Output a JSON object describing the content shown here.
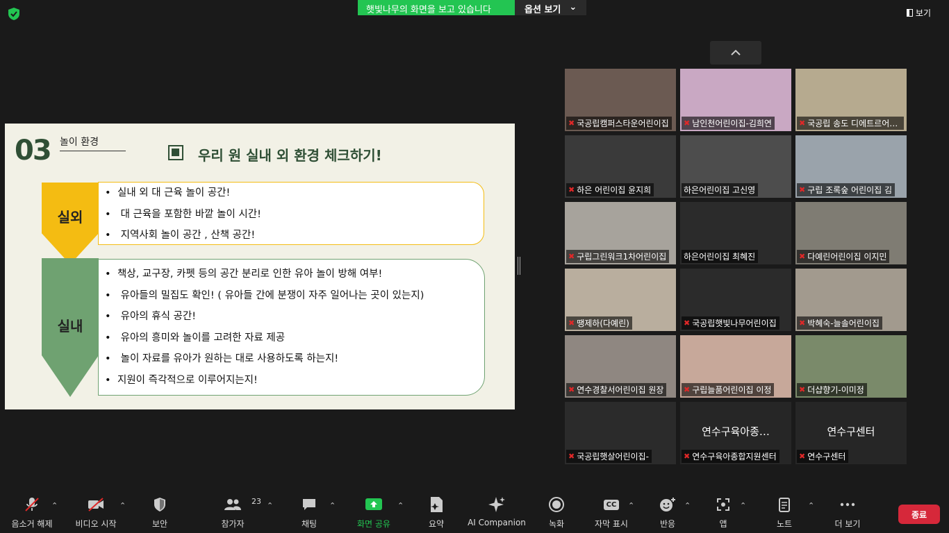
{
  "top": {
    "banner_text": "햇빛나무의 화면을 보고 있습니다",
    "options_label": "옵션 보기",
    "view_label": "보기"
  },
  "slide": {
    "number": "03",
    "section": "놀이 환경",
    "title": "우리 원 실내 외 환경 체크하기!",
    "outdoor_label": "실외",
    "outdoor_items": [
      "실내 외  대 근육 놀이 공간!",
      " 대 근육을 포함한 바깥 놀이 시간!",
      " 지역사회 놀이 공간 , 산책 공간!"
    ],
    "indoor_label": "실내",
    "indoor_items": [
      "책상, 교구장, 카펫 등의 공간 분리로 인한 유아 놀이 방해 여부!",
      " 유아들의 밀집도 확인! ( 유아들 간에 분쟁이 자주 일어나는 곳이 있는지)",
      " 유아의 휴식 공간!",
      " 유아의 흥미와 놀이를 고려한 자료 제공",
      " 놀이 자료를 유아가 원하는 대로 사용하도록 하는지!",
      "지원이 즉각적으로 이루어지는지!"
    ]
  },
  "participants": [
    {
      "name": "국공립캠퍼스타운어린이집",
      "muted": true,
      "bg": "#6b5a52"
    },
    {
      "name": "남인천어린이집-김희연",
      "muted": true,
      "bg": "#c9a8c3"
    },
    {
      "name": "국공립 송도 디에트르어린이집",
      "muted": true,
      "bg": "#b6aa8f"
    },
    {
      "name": "하은 어린이집 윤지희",
      "muted": true,
      "bg": "#3a3a3a"
    },
    {
      "name": "하은어린이집 고신영",
      "muted": false,
      "bg": "#4d4d4d"
    },
    {
      "name": "구립 조록숲 어린이집 김",
      "muted": true,
      "bg": "#9aa3ab"
    },
    {
      "name": "구립그린워크1차어린이집",
      "muted": true,
      "bg": "#a7a39c"
    },
    {
      "name": "하은어린이집 최혜진",
      "muted": false,
      "bg": "#2b2b2b"
    },
    {
      "name": "다예린어린이집 이지민",
      "muted": true,
      "bg": "#7f7c73"
    },
    {
      "name": "땡제하(다예린)",
      "muted": true,
      "bg": "#b9ae9e"
    },
    {
      "name": "국공립햇빛나무어린이집",
      "muted": true,
      "bg": "#2b2b2b"
    },
    {
      "name": "박혜숙-늘솔어린이집",
      "muted": true,
      "bg": "#a29a8e"
    },
    {
      "name": "연수경찰서어린이집 원장",
      "muted": true,
      "bg": "#8f8781"
    },
    {
      "name": "구립늘품어린이집 이정",
      "muted": true,
      "bg": "#c7a89a"
    },
    {
      "name": "더샵향기-이미정",
      "muted": true,
      "bg": "#7a8a6a"
    },
    {
      "name": "국공립햇살어린이집-",
      "muted": true,
      "bg": "#2b2b2b"
    },
    {
      "name": "연수구육아종합지원센터",
      "muted": true,
      "bg": "#262626",
      "center": "연수구육아종…"
    },
    {
      "name": "연수구센터",
      "muted": true,
      "bg": "#262626",
      "center": "연수구센터"
    }
  ],
  "toolbar": {
    "unmute": "음소거 해제",
    "start_video": "비디오 시작",
    "security": "보안",
    "participants": "참가자",
    "participants_count": "23",
    "chat": "채팅",
    "share": "화면 공유",
    "summary": "요약",
    "ai": "AI Companion",
    "record": "녹화",
    "captions": "자막 표시",
    "cc": "CC",
    "reactions": "반응",
    "apps": "앱",
    "notes": "노트",
    "more": "더 보기",
    "end": "종료"
  },
  "colors": {
    "accent_green": "#23c552",
    "end_red": "#d6283a",
    "slide_green": "#2f4f35",
    "outdoor_yellow": "#f4bc12",
    "indoor_green": "#6fa271"
  }
}
